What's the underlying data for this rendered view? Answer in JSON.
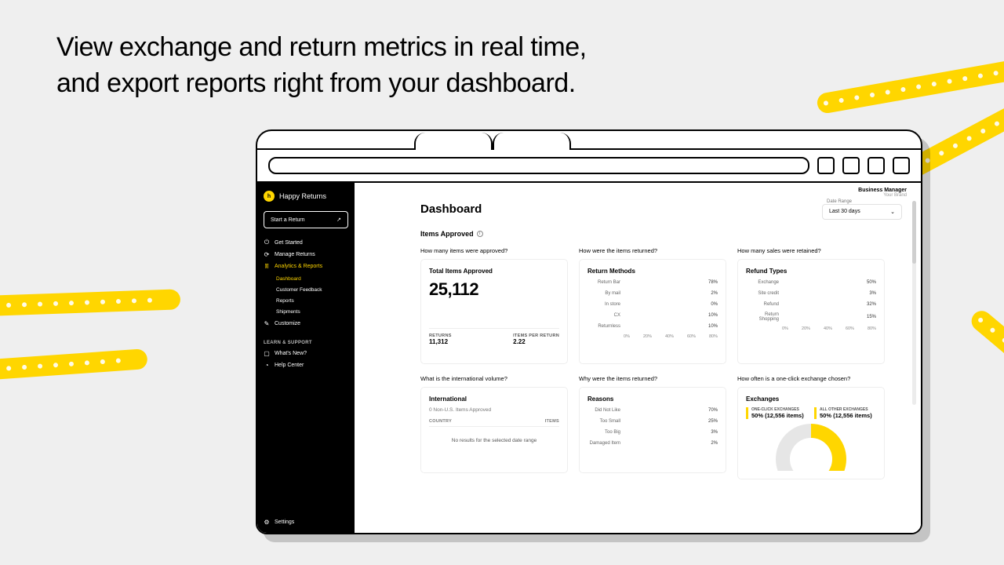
{
  "headline": {
    "line1": "View exchange and return metrics in real time,",
    "line2": "and export reports right from your dashboard."
  },
  "topbar": {
    "business_manager": "Business Manager",
    "your_brand": "Your Brand"
  },
  "sidebar": {
    "brand_name": "Happy Returns",
    "brand_short": "h",
    "start_return": "Start a Return",
    "nav": [
      {
        "label": "Get Started",
        "icon": "power-icon"
      },
      {
        "label": "Manage Returns",
        "icon": "cycle-icon"
      },
      {
        "label": "Analytics & Reports",
        "icon": "chart-icon",
        "active": true
      }
    ],
    "subnav": [
      {
        "label": "Dashboard",
        "active": true
      },
      {
        "label": "Customer Feedback"
      },
      {
        "label": "Reports"
      },
      {
        "label": "Shipments"
      }
    ],
    "customize": "Customize",
    "learn_header": "LEARN & SUPPORT",
    "learn": [
      {
        "label": "What's New?",
        "icon": "doc-icon"
      },
      {
        "label": "Help Center",
        "icon": "help-icon"
      }
    ],
    "settings": "Settings"
  },
  "date_range": {
    "label": "Date Range",
    "value": "Last 30 days"
  },
  "page_title": "Dashboard",
  "section_title": "Items Approved",
  "questions": {
    "q1": "How many items were approved?",
    "q2": "How were the items returned?",
    "q3": "How many sales were retained?",
    "q4": "What is the international volume?",
    "q5": "Why were the items returned?",
    "q6": "How often is a one-click exchange chosen?"
  },
  "total_items": {
    "title": "Total Items Approved",
    "value": "25,112",
    "returns_label": "RETURNS",
    "returns_value": "11,312",
    "ipr_label": "ITEMS PER RETURN",
    "ipr_value": "2.22"
  },
  "return_methods": {
    "title": "Return Methods"
  },
  "refund_types": {
    "title": "Refund Types"
  },
  "international": {
    "title": "International",
    "subtitle": "0 Non-U.S. Items Approved",
    "col1": "COUNTRY",
    "col2": "ITEMS",
    "empty": "No results for the selected date range"
  },
  "reasons": {
    "title": "Reasons"
  },
  "exchanges": {
    "title": "Exchanges",
    "one_click_label": "ONE-CLICK EXCHANGES",
    "one_click_value": "50% (12,556 items)",
    "other_label": "ALL OTHER EXCHANGES",
    "other_value": "50% (12,556 items)"
  },
  "chart_data": [
    {
      "type": "bar",
      "title": "Return Methods",
      "categories": [
        "Return Bar",
        "By mail",
        "In store",
        "CX",
        "Returnless"
      ],
      "values": [
        78,
        2,
        0,
        10,
        10
      ],
      "xlabel": "",
      "ylabel": "",
      "xlim": [
        0,
        100
      ],
      "ticks": [
        "0%",
        "20%",
        "40%",
        "60%",
        "80%"
      ]
    },
    {
      "type": "bar",
      "title": "Refund Types",
      "categories": [
        "Exchange",
        "Site credit",
        "Refund",
        "Return Shopping"
      ],
      "values": [
        50,
        3,
        32,
        15
      ],
      "xlabel": "",
      "ylabel": "",
      "xlim": [
        0,
        100
      ],
      "ticks": [
        "0%",
        "20%",
        "40%",
        "60%",
        "80%"
      ]
    },
    {
      "type": "bar",
      "title": "Reasons",
      "categories": [
        "Did Not Like",
        "Too Small",
        "Too Big",
        "Damaged Item"
      ],
      "values": [
        70,
        25,
        3,
        2
      ],
      "xlabel": "",
      "ylabel": "",
      "xlim": [
        0,
        100
      ]
    },
    {
      "type": "pie",
      "title": "Exchanges",
      "categories": [
        "One-click exchanges",
        "All other exchanges"
      ],
      "values": [
        50,
        50
      ]
    }
  ],
  "colors": {
    "accent": "#ffd600"
  }
}
